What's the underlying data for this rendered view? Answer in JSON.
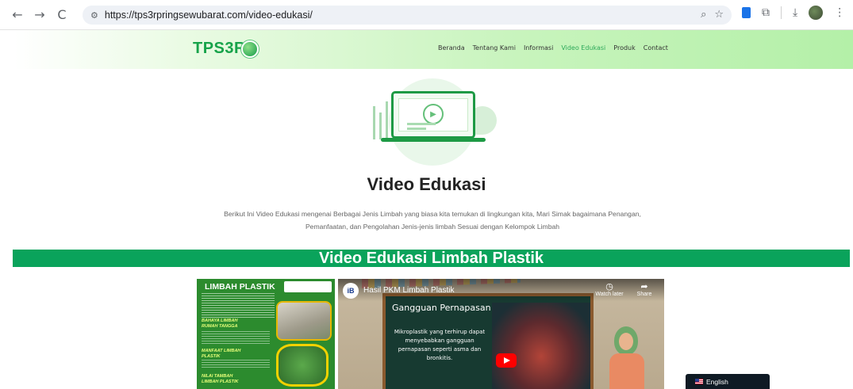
{
  "browser": {
    "back_icon": "←",
    "forward_icon": "→",
    "reload_icon": "C",
    "url": "https://tps3rpringsewubarat.com/video-edukasi/",
    "zoom_icon": "⌕",
    "bookmark_icon": "☆",
    "download_icon": "⤓",
    "menu_icon": "⋮"
  },
  "header": {
    "logo_text": "TPS3R",
    "nav": [
      {
        "label": "Beranda"
      },
      {
        "label": "Tentang Kami"
      },
      {
        "label": "Informasi"
      },
      {
        "label": "Video Edukasi",
        "active": true
      },
      {
        "label": "Produk"
      },
      {
        "label": "Contact"
      }
    ]
  },
  "hero": {
    "title": "Video Edukasi",
    "intro_line1": "Berikut Ini Video Edukasi mengenai Berbagai Jenis Limbah yang biasa kita temukan di lingkungan kita, Mari Simak bagaimana Penangan,",
    "intro_line2": "Pemanfaatan, dan Pengolahan Jenis-jenis limbah Sesuai dengan Kelompok Limbah"
  },
  "section": {
    "title": "Video Edukasi Limbah Plastik"
  },
  "poster": {
    "title": "LIMBAH PLASTIK",
    "sub1": "BAHAYA LIMBAH RUMAH TANGGA",
    "sub2": "MANFAAT LIMBAH PLASTIK",
    "sub3": "NILAI TAMBAH LIMBAH PLASTIK"
  },
  "video": {
    "title": "Hasil PKM Limbah Plastik",
    "watch_later": "Watch later",
    "share": "Share",
    "heading": "Gangguan Pernapasan",
    "body": "Mikroplastik yang terhirup dapat menyebabkan gangguan pernapasan seperti asma dan bronkitis."
  },
  "language": {
    "label": "English"
  },
  "colors": {
    "brand_green": "#17a34a",
    "section_bar": "#0aa35b",
    "active_nav": "#2ea95a"
  }
}
